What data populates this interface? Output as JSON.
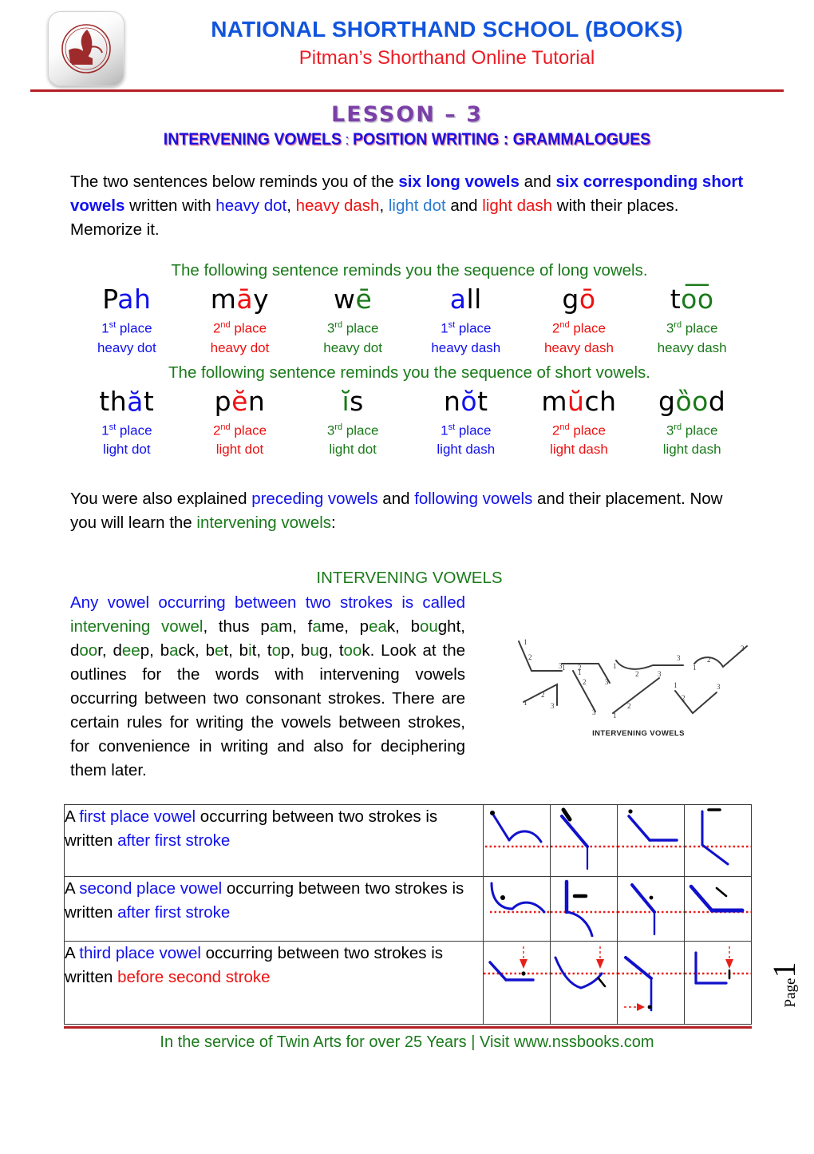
{
  "header": {
    "logo_alt": "nss-logo",
    "school_name": "NATIONAL SHORTHAND SCHOOL (BOOKS)",
    "tutorial_subtitle": "Pitman’s Shorthand Online Tutorial",
    "rule_color": "#b41f24"
  },
  "lesson": {
    "title": "LESSON – 3",
    "title_color": "#7b3fa8",
    "subtitle_part1": "INTERVENING VOWELS",
    "subtitle_sep1": " : ",
    "subtitle_part2": "POSITION WRITING : GRAMMALOGUES",
    "subtitle_color": "#1b11e0"
  },
  "intro": {
    "s1": "The two sentences below reminds you of the ",
    "s2": "six long vowels",
    "s3": " and ",
    "s4": "six corresponding short vowels",
    "s5": " written with ",
    "s6": "heavy dot",
    "s7": ", ",
    "s8": "heavy dash",
    "s9": ", ",
    "s10": "light dot",
    "s11": " and ",
    "s12": "light dash",
    "s13": " with their places. Memorize it."
  },
  "long_vowels": {
    "note": "The following sentence reminds you the sequence of long vowels.",
    "items": [
      {
        "word_pre": "P",
        "word_vowel": "ah",
        "word_post": "",
        "vowel_color": "#1111ee",
        "place": "1",
        "place_sup": "st",
        "place_label": " place",
        "kind": "heavy dot",
        "color": "#1111ee"
      },
      {
        "word_pre": "m",
        "word_vowel": "ā",
        "word_post": "y",
        "vowel_color": "#ee1111",
        "place": "2",
        "place_sup": "nd",
        "place_label": " place",
        "kind": "heavy dot",
        "color": "#ee1111"
      },
      {
        "word_pre": "w",
        "word_vowel": "ē",
        "word_post": "",
        "vowel_color": "#1a7a1a",
        "place": "3",
        "place_sup": "rd",
        "place_label": " place",
        "kind": "heavy dot",
        "color": "#1a7a1a"
      },
      {
        "word_pre": "",
        "word_vowel": "a",
        "word_post": "ll",
        "vowel_color": "#1111ee",
        "place": "1",
        "place_sup": "st",
        "place_label": " place",
        "kind": "heavy dash",
        "color": "#1111ee"
      },
      {
        "word_pre": "g",
        "word_vowel": "ō",
        "word_post": "",
        "vowel_color": "#ee1111",
        "place": "2",
        "place_sup": "nd",
        "place_label": " place",
        "kind": "heavy dash",
        "color": "#ee1111"
      },
      {
        "word_pre": "t",
        "word_vowel": "o͞o",
        "word_post": "",
        "vowel_color": "#1a7a1a",
        "place": "3",
        "place_sup": "rd",
        "place_label": " place",
        "kind": "heavy dash",
        "color": "#1a7a1a"
      }
    ]
  },
  "short_vowels": {
    "note": "The following sentence reminds you the sequence of short vowels.",
    "items": [
      {
        "word_pre": "th",
        "word_vowel": "ă",
        "word_post": "t",
        "vowel_color": "#1111ee",
        "place": "1",
        "place_sup": "st",
        "place_label": " place",
        "kind": "light dot",
        "color": "#1111ee"
      },
      {
        "word_pre": "p",
        "word_vowel": "ĕ",
        "word_post": "n",
        "vowel_color": "#ee1111",
        "place": "2",
        "place_sup": "nd",
        "place_label": " place",
        "kind": "light dot",
        "color": "#ee1111"
      },
      {
        "word_pre": "",
        "word_vowel": "ĭ",
        "word_post": "s",
        "vowel_color": "#1a7a1a",
        "place": "3",
        "place_sup": "rd",
        "place_label": " place",
        "kind": "light dot",
        "color": "#1a7a1a"
      },
      {
        "word_pre": "n",
        "word_vowel": "ŏ",
        "word_post": "t",
        "vowel_color": "#1111ee",
        "place": "1",
        "place_sup": "st",
        "place_label": " place",
        "kind": "light dash",
        "color": "#1111ee"
      },
      {
        "word_pre": "m",
        "word_vowel": "ŭ",
        "word_post": "ch",
        "vowel_color": "#ee1111",
        "place": "2",
        "place_sup": "nd",
        "place_label": " place",
        "kind": "light dash",
        "color": "#ee1111"
      },
      {
        "word_pre": "g",
        "word_vowel": "ȍo",
        "word_post": "d",
        "vowel_color": "#1a7a1a",
        "place": "3",
        "place_sup": "rd",
        "place_label": " place",
        "kind": "light dash",
        "color": "#1a7a1a"
      }
    ]
  },
  "explained": {
    "p1": "You were also explained ",
    "p2": "preceding vowels",
    "p3": " and ",
    "p4": "following vowels",
    "p5": " and their placement.  Now you will learn the ",
    "p6": "intervening vowels",
    "p7": ":"
  },
  "section": {
    "heading": "INTERVENING VOWELS",
    "d1": "Any vowel occurring between two strokes is called ",
    "d2": "intervening vowel",
    "d3": ", thus ",
    "words": "pam, fame, peak, bought, door, deep, back, bet, bit, top, bug, took.",
    "d4": "  Look at the outlines for the words with intervening vowels occurring between two consonant strokes.   There are certain rules for writing the vowels between strokes, for convenience in writing and also for deciphering them later."
  },
  "figure": {
    "caption": "INTERVENING VOWELS",
    "stroke_numbers": [
      "1",
      "2",
      "3"
    ]
  },
  "rules": [
    {
      "t1": "A ",
      "t2": "first place vowel",
      "t3": " occurring between two strokes is written ",
      "t4": "after first stroke",
      "t4_color": "#1111ee"
    },
    {
      "t1": "A ",
      "t2": "second place vowel",
      "t3": " occurring between two strokes is written ",
      "t4": "after first stroke",
      "t4_color": "#1111ee"
    },
    {
      "t1": "A ",
      "t2": "third place vowel",
      "t3": " occurring between two strokes is written ",
      "t4": "before second stroke",
      "t4_color": "#ee1111"
    }
  ],
  "footer": {
    "text": "In the service of Twin Arts for over 25 Years | Visit www.nssbooks.com",
    "color": "#1a7a1a"
  },
  "page_marker": {
    "label": "Page",
    "number": "1"
  }
}
